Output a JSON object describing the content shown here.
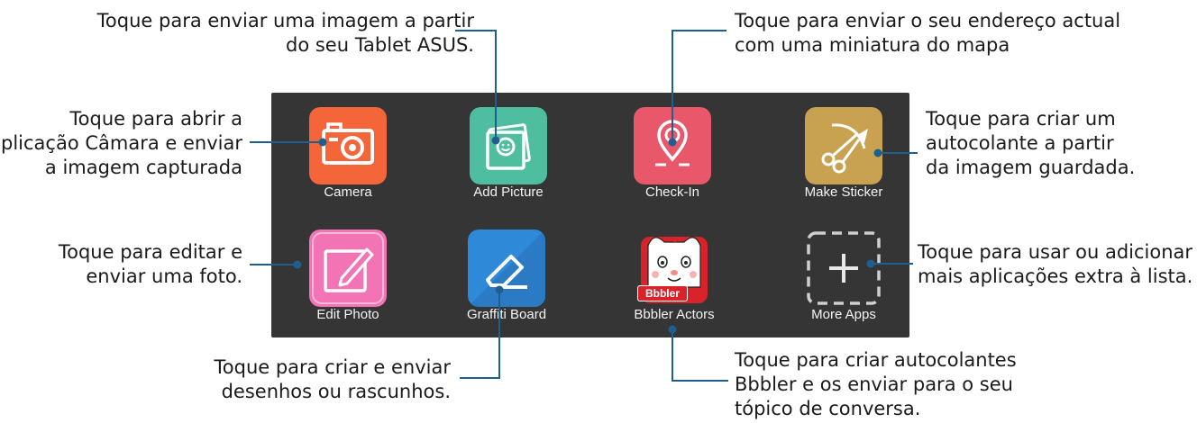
{
  "callouts": {
    "add_picture": [
      "Toque para enviar uma imagem a partir",
      "do seu Tablet ASUS."
    ],
    "check_in": [
      "Toque para enviar o seu endereço actual",
      "com uma miniatura do mapa"
    ],
    "camera": [
      "Toque para abrir a",
      "aplicação Câmara e enviar",
      "a imagem capturada"
    ],
    "make_sticker": [
      "Toque para criar um",
      "autocolante a partir",
      "da imagem guardada."
    ],
    "edit_photo": [
      "Toque para editar e",
      "enviar uma foto."
    ],
    "more_apps": [
      "Toque para usar ou adicionar",
      "mais aplicações extra à lista."
    ],
    "graffiti_board": [
      "Toque para criar e enviar",
      "desenhos ou rascunhos."
    ],
    "bbbler_actors": [
      "Toque para criar autocolantes",
      "Bbbler e os enviar para o seu",
      "tópico de conversa."
    ]
  },
  "apps": [
    {
      "label": "Camera",
      "icon": "camera-icon",
      "color": "#f4663a"
    },
    {
      "label": "Add Picture",
      "icon": "add-picture-icon",
      "color": "#4fbda0"
    },
    {
      "label": "Check-In",
      "icon": "location-pin-icon",
      "color": "#e8586a"
    },
    {
      "label": "Make Sticker",
      "icon": "scissors-icon",
      "color": "#c8a251"
    },
    {
      "label": "Edit Photo",
      "icon": "pencil-icon",
      "color": "#f274b4"
    },
    {
      "label": "Graffiti Board",
      "icon": "eraser-icon",
      "color": "#2e8ad8"
    },
    {
      "label": "Bbbler Actors",
      "icon": "bbbler-character-icon",
      "color": "#d8232a",
      "badge": "Bbbler"
    },
    {
      "label": "More Apps",
      "icon": "plus-icon",
      "color": "#353535"
    }
  ],
  "colors": {
    "panel": "#353535",
    "callout_line": "#1f5f8f",
    "text": "#1a1a1a"
  }
}
